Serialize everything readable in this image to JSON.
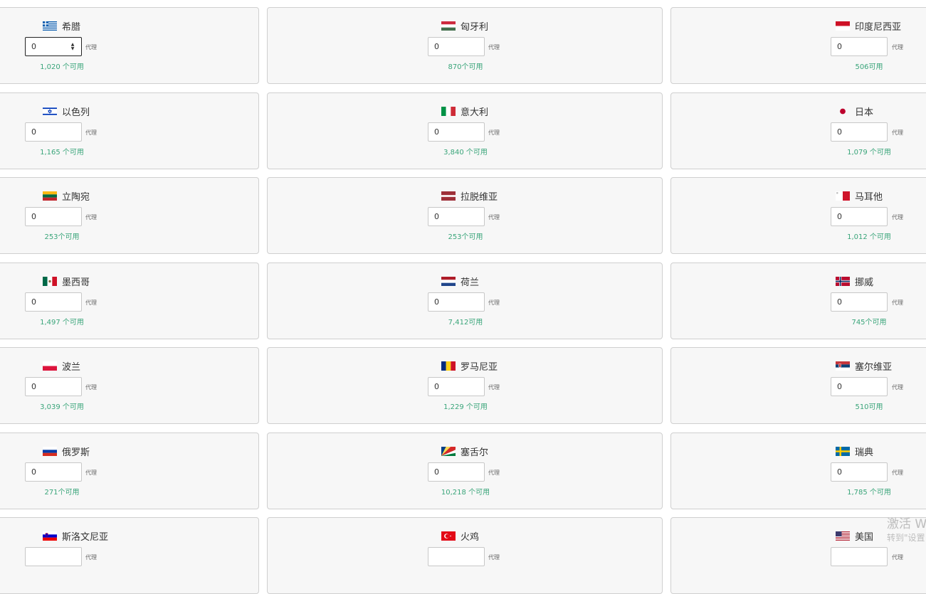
{
  "unit_label": "代理",
  "countries": [
    {
      "name": "希腊",
      "qty": "0",
      "available": "1,020 个可用",
      "flag": "greece"
    },
    {
      "name": "匈牙利",
      "qty": "0",
      "available": "870个可用",
      "flag": "hungary"
    },
    {
      "name": "印度尼西亚",
      "qty": "0",
      "available": "506可用",
      "flag": "indonesia"
    },
    {
      "name": "以色列",
      "qty": "0",
      "available": "1,165 个可用",
      "flag": "israel"
    },
    {
      "name": "意大利",
      "qty": "0",
      "available": "3,840 个可用",
      "flag": "italy"
    },
    {
      "name": "日本",
      "qty": "0",
      "available": "1,079 个可用",
      "flag": "japan"
    },
    {
      "name": "立陶宛",
      "qty": "0",
      "available": "253个可用",
      "flag": "lithuania"
    },
    {
      "name": "拉脱维亚",
      "qty": "0",
      "available": "253个可用",
      "flag": "latvia"
    },
    {
      "name": "马耳他",
      "qty": "0",
      "available": "1,012 个可用",
      "flag": "malta"
    },
    {
      "name": "墨西哥",
      "qty": "0",
      "available": "1,497 个可用",
      "flag": "mexico"
    },
    {
      "name": "荷兰",
      "qty": "0",
      "available": "7,412可用",
      "flag": "netherlands"
    },
    {
      "name": "挪威",
      "qty": "0",
      "available": "745个可用",
      "flag": "norway"
    },
    {
      "name": "波兰",
      "qty": "0",
      "available": "3,039 个可用",
      "flag": "poland"
    },
    {
      "name": "罗马尼亚",
      "qty": "0",
      "available": "1,229 个可用",
      "flag": "romania"
    },
    {
      "name": "塞尔维亚",
      "qty": "0",
      "available": "510可用",
      "flag": "serbia"
    },
    {
      "name": "俄罗斯",
      "qty": "0",
      "available": "271个可用",
      "flag": "russia"
    },
    {
      "name": "塞舌尔",
      "qty": "0",
      "available": "10,218 个可用",
      "flag": "seychelles"
    },
    {
      "name": "瑞典",
      "qty": "0",
      "available": "1,785 个可用",
      "flag": "sweden"
    },
    {
      "name": "斯洛文尼亚",
      "qty": "",
      "available": "",
      "flag": "slovenia"
    },
    {
      "name": "火鸡",
      "qty": "",
      "available": "",
      "flag": "turkey"
    },
    {
      "name": "美国",
      "qty": "",
      "available": "",
      "flag": "usa"
    }
  ],
  "watermark": {
    "line1": "激活 W",
    "line2": "转到\"设置"
  },
  "colors": {
    "available_text": "#3aa57a",
    "card_bg": "#f7f7f7",
    "card_border": "#cfcfcf"
  }
}
